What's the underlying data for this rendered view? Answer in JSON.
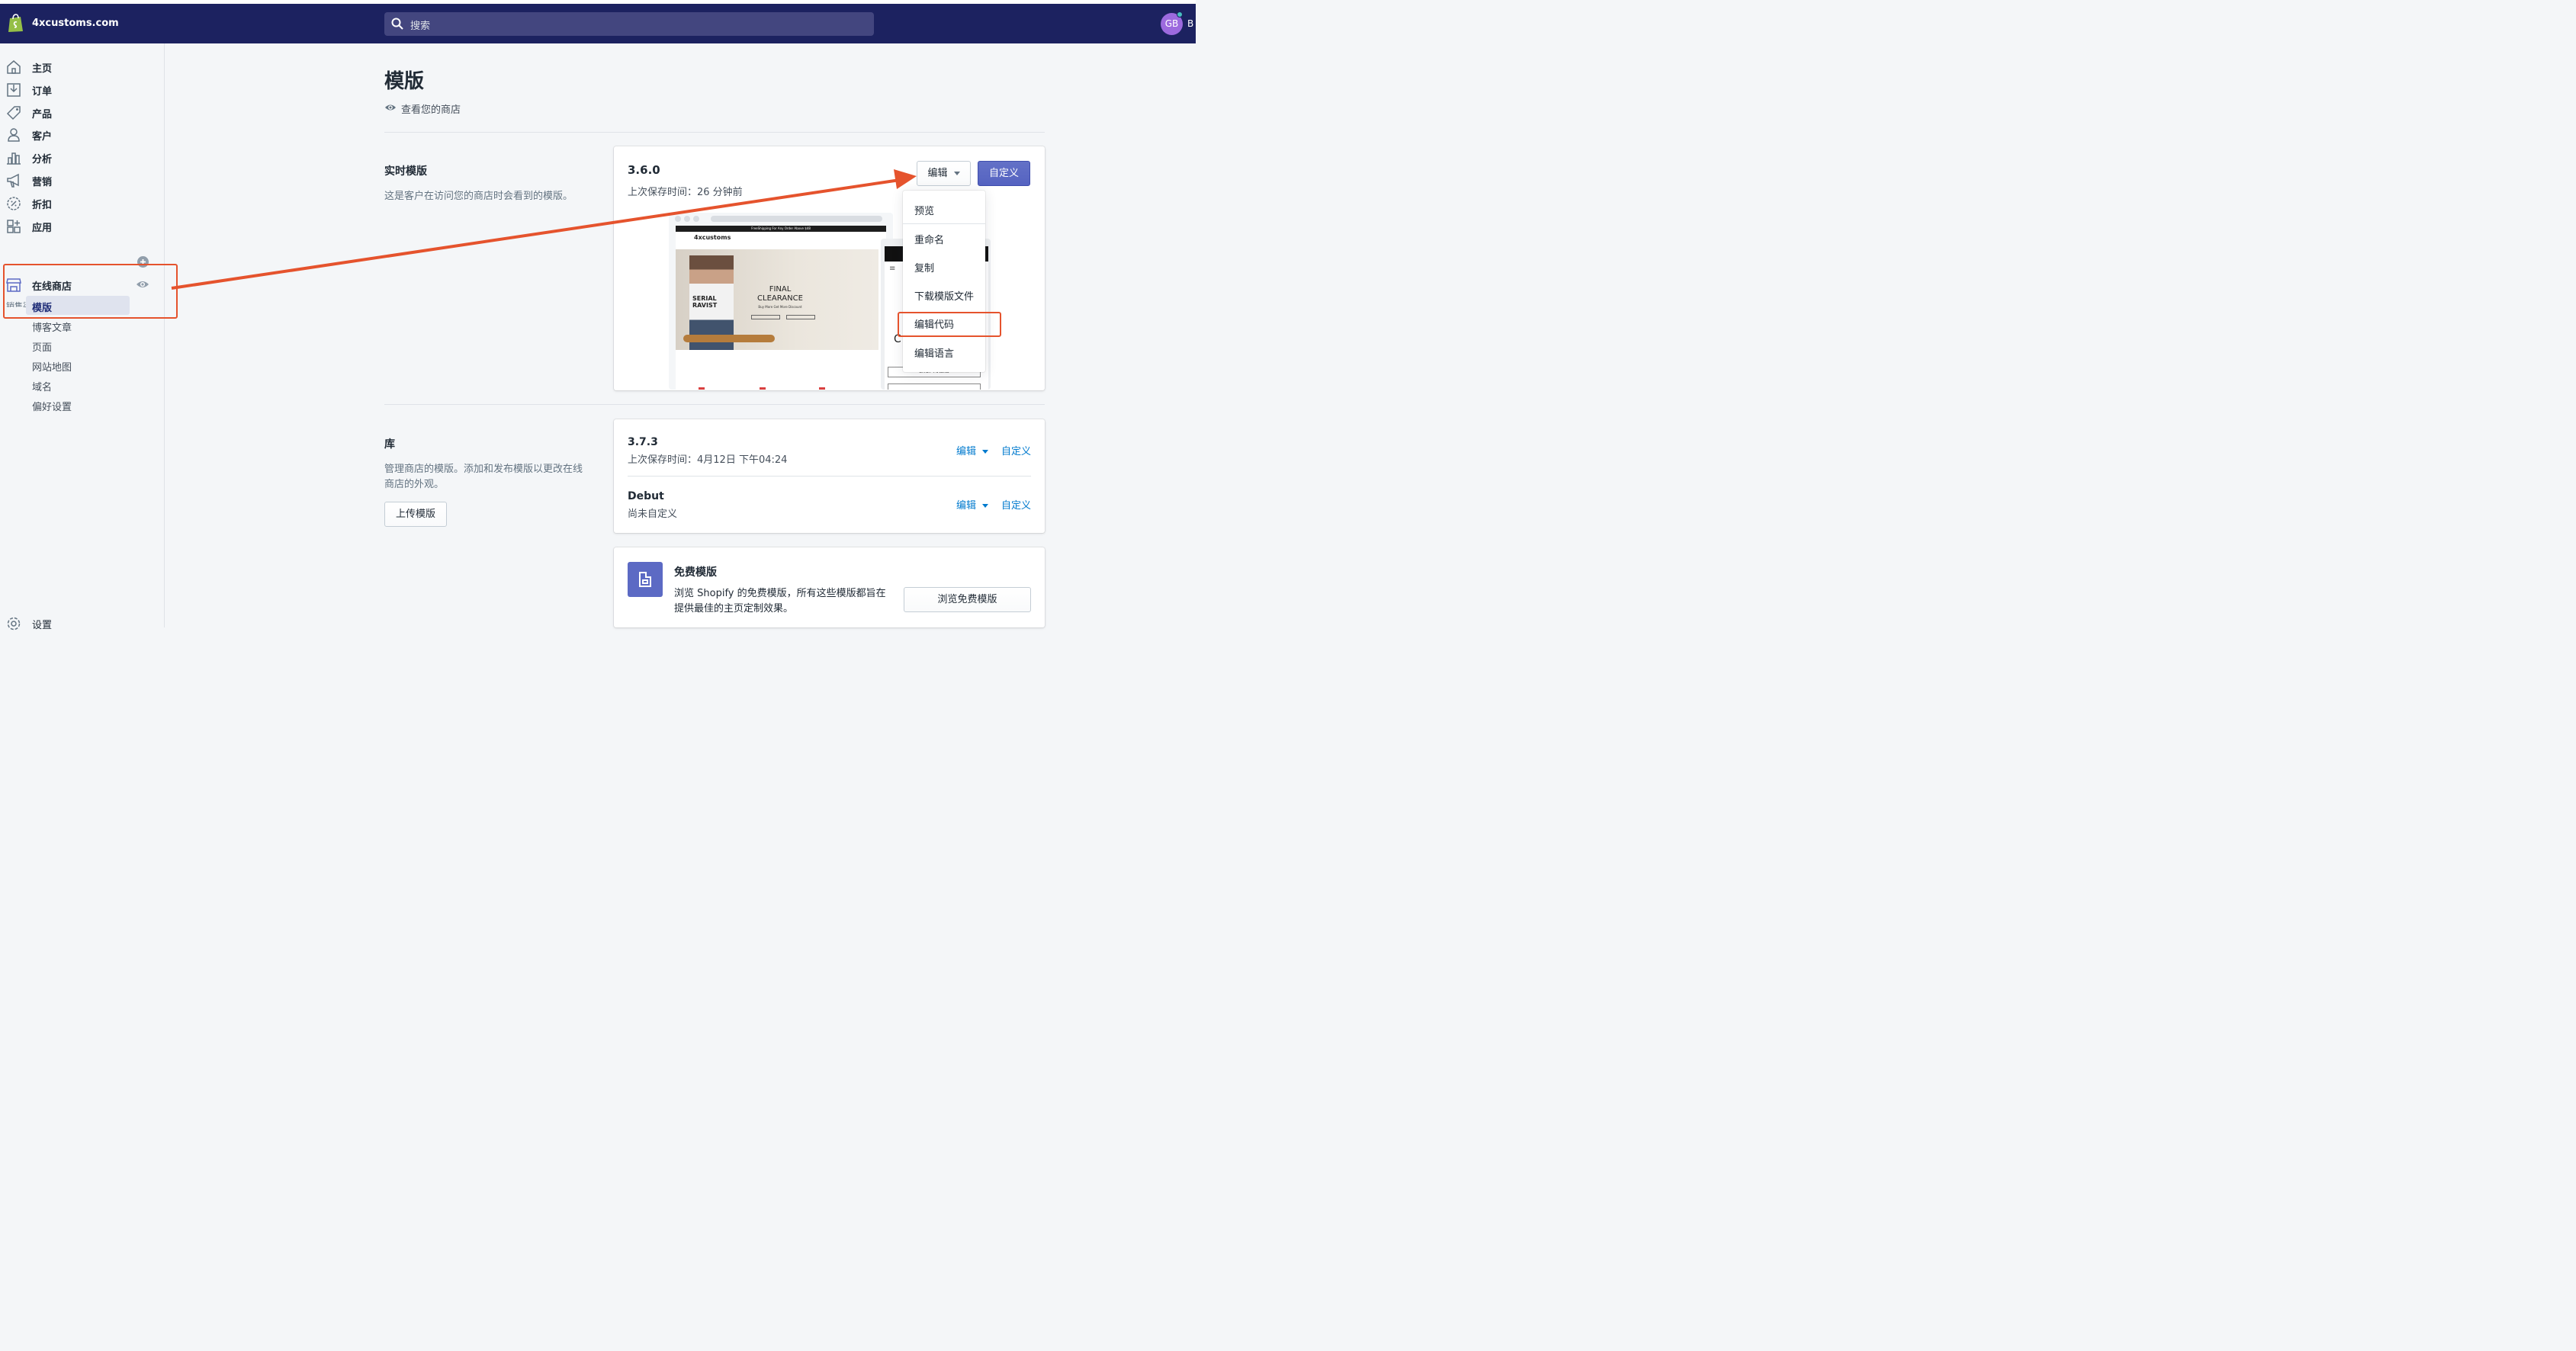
{
  "topbar": {
    "store_name": "4xcustoms.com",
    "search_placeholder": "搜索",
    "avatar_initials": "GB",
    "avatar_name_fragment": "B"
  },
  "sidebar": {
    "items": [
      {
        "label": "主页",
        "icon": "home-icon"
      },
      {
        "label": "订单",
        "icon": "orders-icon"
      },
      {
        "label": "产品",
        "icon": "tag-icon"
      },
      {
        "label": "客户",
        "icon": "customer-icon"
      },
      {
        "label": "分析",
        "icon": "analytics-icon"
      },
      {
        "label": "营销",
        "icon": "megaphone-icon"
      },
      {
        "label": "折扣",
        "icon": "discount-icon"
      },
      {
        "label": "应用",
        "icon": "apps-icon"
      }
    ],
    "channels_label": "销售渠道",
    "online_store": "在线商店",
    "sub_items": [
      "模版",
      "博客文章",
      "页面",
      "网站地图",
      "域名",
      "偏好设置"
    ],
    "settings": "设置"
  },
  "main": {
    "title": "模版",
    "view_store": "查看您的商店",
    "live": {
      "title": "实时模版",
      "desc": "这是客户在访问您的商店时会看到的模版。",
      "version": "3.6.0",
      "saved": "上次保存时间：26 分钟前",
      "edit_label": "编辑",
      "customize_label": "自定义"
    },
    "dropdown": [
      "预览",
      "重命名",
      "复制",
      "下载模版文件",
      "编辑代码",
      "编辑语言"
    ],
    "library": {
      "title": "库",
      "desc_line1": "管理商店的模版。添加和发布模版以更改在线",
      "desc_line2": "商店的外观。",
      "upload_label": "上传模版",
      "themes": [
        {
          "name": "3.7.3",
          "status": "上次保存时间：4月12日 下午04:24",
          "edit": "编辑",
          "customize": "自定义"
        },
        {
          "name": "Debut",
          "status": "尚未自定义",
          "edit": "编辑",
          "customize": "自定义"
        }
      ]
    },
    "free": {
      "title": "免费模版",
      "desc_line1": "浏览 Shopify 的免费模版，所有这些模版都旨在",
      "desc_line2": "提供最佳的主页定制效果。",
      "button": "浏览免费模版"
    },
    "preview": {
      "brand": "4xcustoms",
      "banner": "FreeShipping For Any Order Above $48",
      "hero_line1": "FINAL",
      "hero_line2": "CLEARANCE",
      "hero_sub": "Buy More Get More Discount",
      "shirt_line1": "SERIAL",
      "shirt_line2": "RAVIST",
      "mobile_shop_masks": "SHOP MASKS",
      "mobile_letter": "C"
    }
  },
  "colors": {
    "topbar": "#1c2260",
    "primary": "#5c6ac4",
    "annotation": "#e5532d",
    "link": "#007ace"
  }
}
